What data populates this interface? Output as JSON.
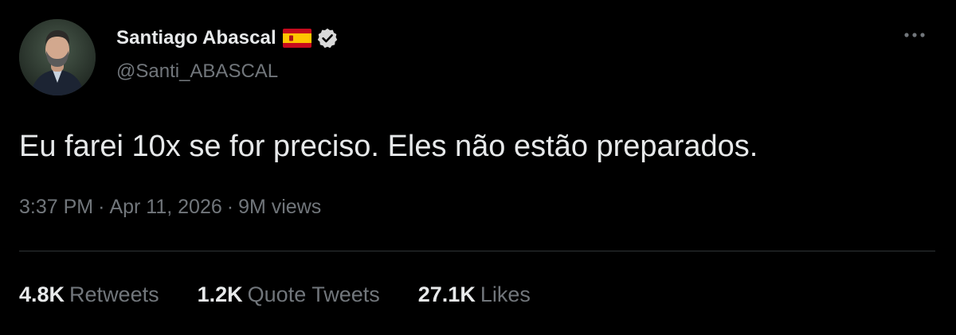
{
  "author": {
    "display_name": "Santiago Abascal",
    "handle": "@Santi_ABASCAL",
    "flag_emoji": "🇪🇸",
    "verified_icon": "verified-badge-icon"
  },
  "menu": {
    "more_icon": "more-options-icon"
  },
  "tweet": {
    "text": "Eu farei 10x se for preciso. Eles não estão preparados."
  },
  "meta": {
    "time": "3:37 PM",
    "separator": "·",
    "date": "Apr 11, 2026",
    "views": "9M views"
  },
  "stats": [
    {
      "count": "4.8K",
      "label": "Retweets"
    },
    {
      "count": "1.2K",
      "label": "Quote Tweets"
    },
    {
      "count": "27.1K",
      "label": "Likes"
    }
  ],
  "colors": {
    "background": "#000000",
    "primary_text": "#e7e9ea",
    "secondary_text": "#71767b",
    "divider": "#2f3336",
    "flag_red": "#c60b1e",
    "flag_yellow": "#ffc400"
  }
}
